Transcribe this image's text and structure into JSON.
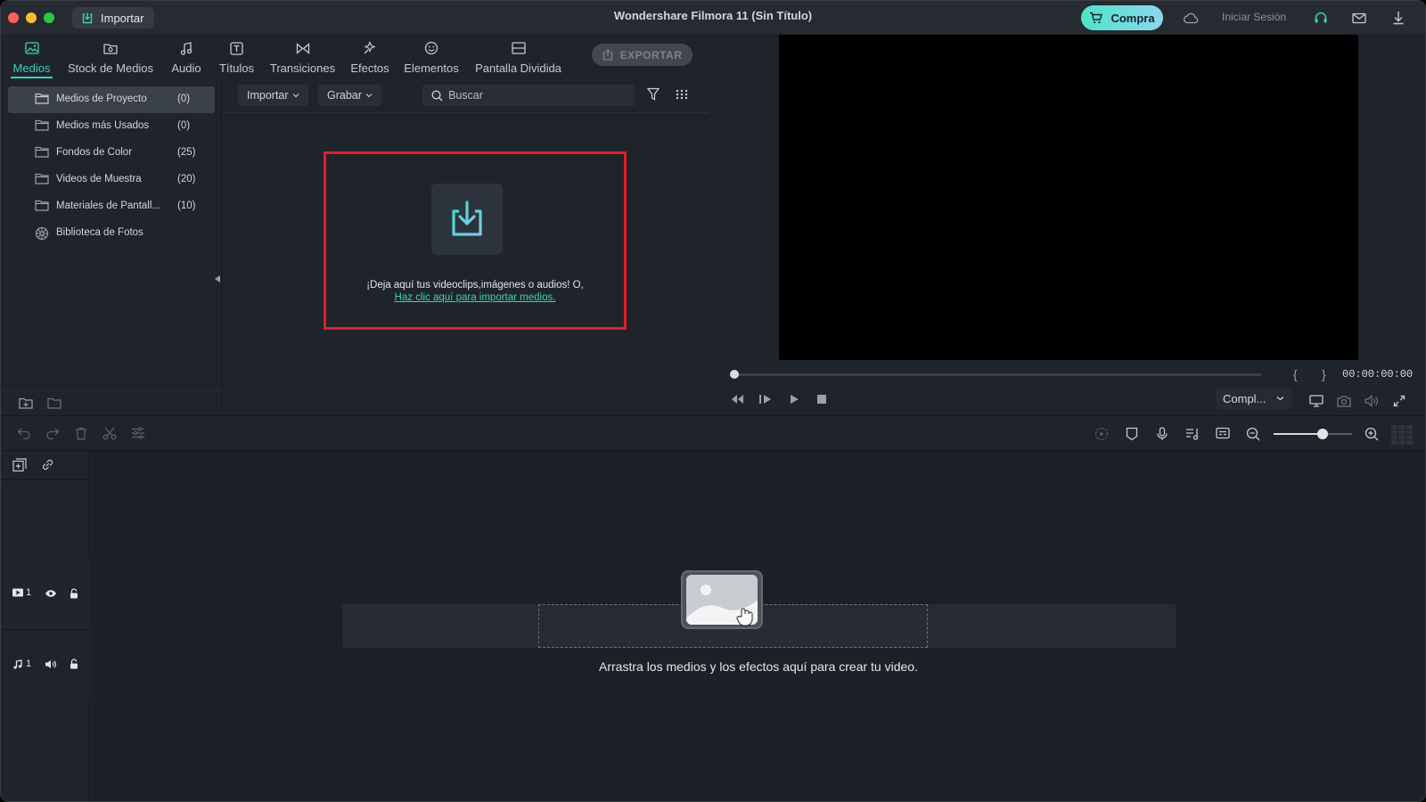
{
  "titlebar": {
    "import_button": "Importar",
    "app_title": "Wondershare Filmora 11 (Sin Título)",
    "buy_button": "Compra",
    "login": "Iniciar Sesión"
  },
  "tabs": [
    {
      "label": "Medios",
      "icon": "media-icon",
      "active": true
    },
    {
      "label": "Stock de Medios",
      "icon": "stock-media-icon"
    },
    {
      "label": "Audio",
      "icon": "music-note-icon"
    },
    {
      "label": "Títulos",
      "icon": "titles-icon"
    },
    {
      "label": "Transiciones",
      "icon": "transitions-icon"
    },
    {
      "label": "Efectos",
      "icon": "effects-icon"
    },
    {
      "label": "Elementos",
      "icon": "elements-icon"
    },
    {
      "label": "Pantalla Dividida",
      "icon": "split-screen-icon"
    }
  ],
  "export_button": "EXPORTAR",
  "sidebar": {
    "items": [
      {
        "label": "Medios de Proyecto",
        "count": "(0)",
        "icon": "folder-icon"
      },
      {
        "label": "Medios más Usados",
        "count": "(0)",
        "icon": "folder-icon"
      },
      {
        "label": "Fondos de Color",
        "count": "(25)",
        "icon": "folder-icon"
      },
      {
        "label": "Videos de Muestra",
        "count": "(20)",
        "icon": "folder-icon"
      },
      {
        "label": "Materiales de Pantall...",
        "count": "(10)",
        "icon": "folder-icon"
      },
      {
        "label": "Biblioteca de Fotos",
        "count": "",
        "icon": "photo-library-icon"
      }
    ]
  },
  "content": {
    "import_dropdown": "Importar",
    "record_dropdown": "Grabar",
    "search_placeholder": "Buscar",
    "drop_text": "¡Deja aquí tus videoclips,imágenes o audios! O,",
    "drop_link": "Haz clic aquí para importar medios."
  },
  "preview": {
    "timecode": "00:00:00:00",
    "mark_in": "{",
    "mark_out": "}",
    "quality": "Compl...",
    "progress": 0
  },
  "timeline": {
    "video_track": "1",
    "audio_track": "1",
    "hint": "Arrastra los medios y los efectos aquí para crear tu video.",
    "zoom_level": 0.62
  },
  "colors": {
    "accent": "#39d3b9",
    "highlight_border": "#e0202a",
    "background": "#1f242b"
  }
}
